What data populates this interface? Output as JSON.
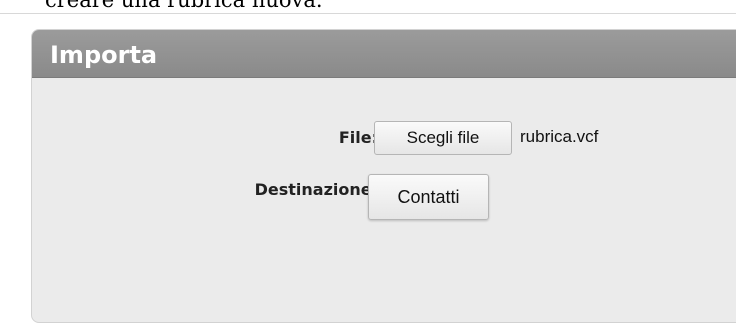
{
  "intro_text": "creare una rubrica nuova.",
  "panel": {
    "title": "Importa",
    "file_label": "File:",
    "choose_file_button": "Scegli file",
    "selected_file": "rubrica.vcf",
    "destination_label": "Destinazione:",
    "destination_value": "Contatti"
  }
}
